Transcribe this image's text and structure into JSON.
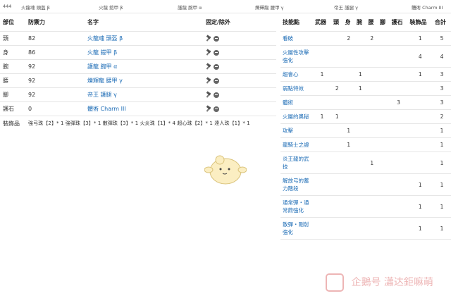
{
  "topbar": {
    "defense": "444",
    "items": [
      "火龍魂 頭盔 β",
      "火龍 鎧甲 β",
      "護龍 腕甲 α",
      "爍輝龍 腰甲 γ",
      "帝王 護腿 γ",
      "體術 Charm III"
    ]
  },
  "armor_table": {
    "headers": {
      "slot": "部位",
      "defense": "防禦力",
      "name": "名字",
      "fix": "固定/除外"
    },
    "rows": [
      {
        "slot": "頭",
        "defense": "82",
        "name": "火龍魂 頭盔 β"
      },
      {
        "slot": "身",
        "defense": "86",
        "name": "火龍 鎧甲 β"
      },
      {
        "slot": "腕",
        "defense": "92",
        "name": "護龍 腕甲 α"
      },
      {
        "slot": "腰",
        "defense": "92",
        "name": "爍輝龍 腰甲 γ"
      },
      {
        "slot": "腳",
        "defense": "92",
        "name": "帝王 護腿 γ"
      },
      {
        "slot": "護石",
        "defense": "0",
        "name": "體術 Charm III"
      }
    ],
    "decorations": {
      "label": "裝飾品",
      "text": "強弓珠【2】* 1 強彈珠【3】* 1 散彈珠【3】* 1 火炎珠【1】* 4 超心珠【2】* 1 達人珠【1】* 1"
    }
  },
  "skill_table": {
    "headers": [
      "技能點",
      "武器",
      "頭",
      "身",
      "腕",
      "腰",
      "腳",
      "護石",
      "裝飾品",
      "合計"
    ],
    "rows": [
      {
        "skill": "看破",
        "values": [
          "",
          "",
          "",
          "2",
          "",
          "2",
          "",
          "",
          "1",
          "5"
        ]
      },
      {
        "skill": "火屬性攻擊強化",
        "values": [
          "",
          "",
          "",
          "",
          "",
          "",
          "",
          "",
          "4",
          "4"
        ]
      },
      {
        "skill": "超會心",
        "values": [
          "",
          "1",
          "",
          "",
          "1",
          "",
          "",
          "",
          "1",
          "3"
        ]
      },
      {
        "skill": "弱點特效",
        "values": [
          "",
          "",
          "2",
          "",
          "1",
          "",
          "",
          "",
          "",
          "3"
        ]
      },
      {
        "skill": "體術",
        "values": [
          "",
          "",
          "",
          "",
          "",
          "",
          "",
          "3",
          "",
          "3"
        ]
      },
      {
        "skill": "火屬的奧秘",
        "values": [
          "",
          "1",
          "1",
          "",
          "",
          "",
          "",
          "",
          "",
          "2"
        ]
      },
      {
        "skill": "攻擊",
        "values": [
          "",
          "",
          "",
          "1",
          "",
          "",
          "",
          "",
          "",
          "1"
        ]
      },
      {
        "skill": "龍騎士之證",
        "values": [
          "",
          "",
          "",
          "1",
          "",
          "",
          "",
          "",
          "",
          "1"
        ]
      },
      {
        "skill": "炎王龍的武技",
        "values": [
          "",
          "",
          "",
          "",
          "",
          "1",
          "",
          "",
          "",
          "1"
        ]
      },
      {
        "skill": "解放弓的蓄力階段",
        "values": [
          "",
          "",
          "",
          "",
          "",
          "",
          "",
          "",
          "1",
          "1"
        ]
      },
      {
        "skill": "通常彈・通常箭強化",
        "values": [
          "",
          "",
          "",
          "",
          "",
          "",
          "",
          "",
          "1",
          "1"
        ]
      },
      {
        "skill": "散彈・剛射強化",
        "values": [
          "",
          "",
          "",
          "",
          "",
          "",
          "",
          "",
          "1",
          "1"
        ]
      }
    ]
  },
  "watermark": {
    "text": "企鵝号 瀟达鉅嘛萌"
  },
  "icons": {
    "pin": "pin-icon",
    "remove": "minus-circle-icon"
  },
  "colors": {
    "link": "#1b6bb5",
    "border": "#e6e6e6"
  }
}
